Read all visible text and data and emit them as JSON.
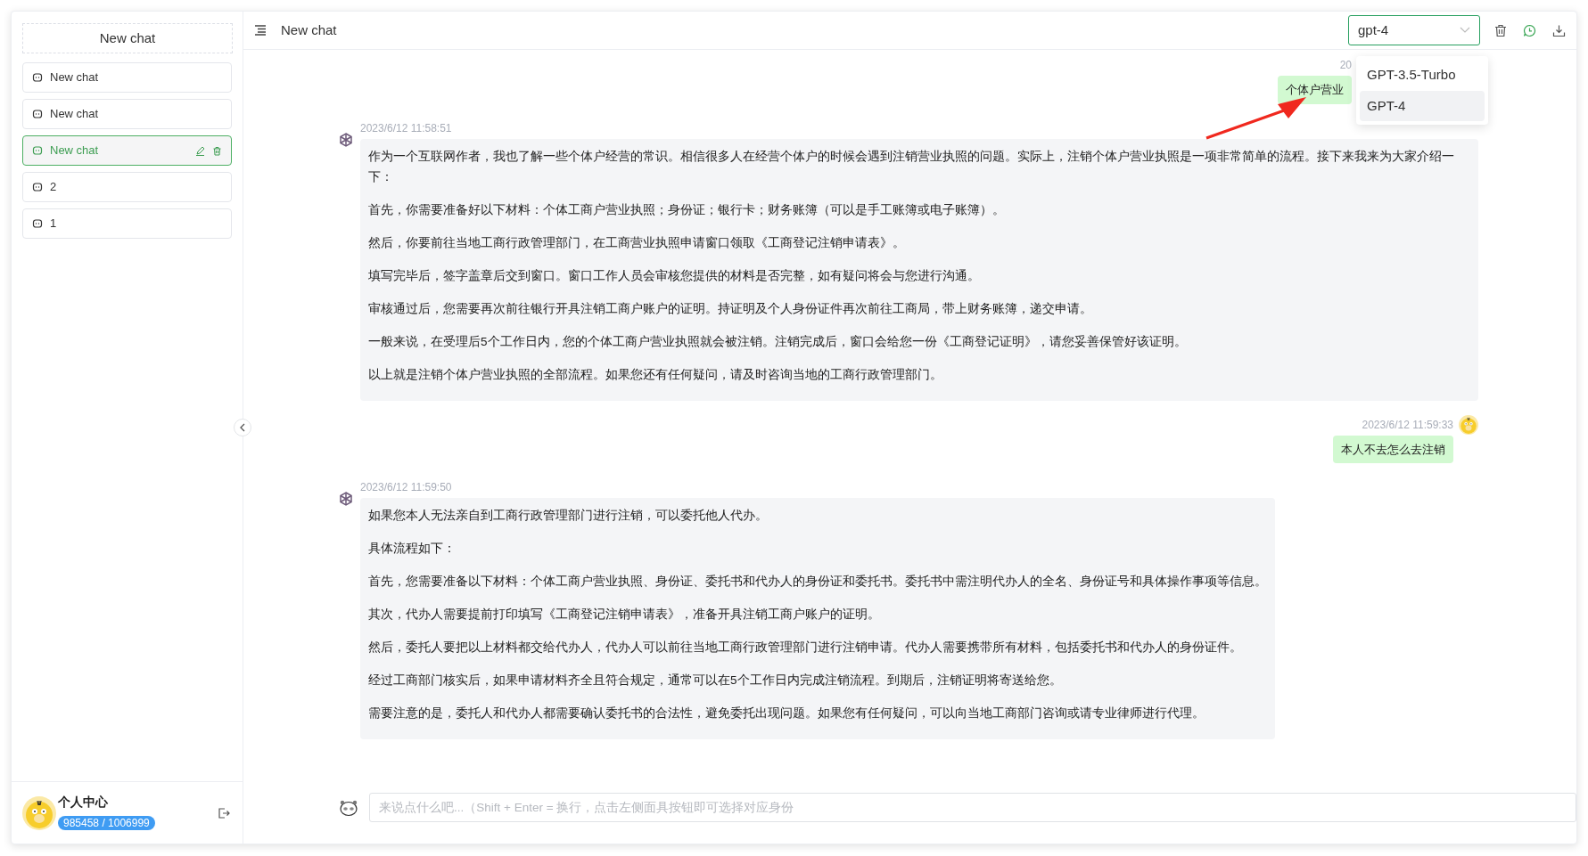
{
  "sidebar": {
    "new_chat_button": "New chat",
    "conversations": [
      {
        "title": "New chat",
        "selected": false
      },
      {
        "title": "New chat",
        "selected": false
      },
      {
        "title": "New chat",
        "selected": true
      },
      {
        "title": "2",
        "selected": false
      },
      {
        "title": "1",
        "selected": false
      }
    ],
    "user": {
      "name": "个人中心",
      "balance": "985458 / 1006999"
    }
  },
  "header": {
    "title": "New chat",
    "model_select": {
      "value": "gpt-4",
      "expanded": true,
      "options": [
        {
          "label": "GPT-3.5-Turbo",
          "selected": false
        },
        {
          "label": "GPT-4",
          "selected": true
        }
      ]
    }
  },
  "messages": [
    {
      "kind": "user",
      "time": "20",
      "paragraphs": [
        "个体户营业"
      ]
    },
    {
      "kind": "assistant",
      "time": "2023/6/12 11:58:51",
      "paragraphs": [
        "作为一个互联网作者，我也了解一些个体户经营的常识。相信很多人在经营个体户的时候会遇到注销营业执照的问题。实际上，注销个体户营业执照是一项非常简单的流程。接下来我来为大家介绍一下：",
        "首先，你需要准备好以下材料：个体工商户营业执照；身份证；银行卡；财务账簿（可以是手工账簿或电子账簿）。",
        "然后，你要前往当地工商行政管理部门，在工商营业执照申请窗口领取《工商登记注销申请表》。",
        "填写完毕后，签字盖章后交到窗口。窗口工作人员会审核您提供的材料是否完整，如有疑问将会与您进行沟通。",
        "审核通过后，您需要再次前往银行开具注销工商户账户的证明。持证明及个人身份证件再次前往工商局，带上财务账簿，递交申请。",
        "一般来说，在受理后5个工作日内，您的个体工商户营业执照就会被注销。注销完成后，窗口会给您一份《工商登记证明》，请您妥善保管好该证明。",
        "以上就是注销个体户营业执照的全部流程。如果您还有任何疑问，请及时咨询当地的工商行政管理部门。"
      ]
    },
    {
      "kind": "user",
      "time": "2023/6/12 11:59:33",
      "paragraphs": [
        "本人不去怎么去注销"
      ]
    },
    {
      "kind": "assistant",
      "time": "2023/6/12 11:59:50",
      "paragraphs": [
        "如果您本人无法亲自到工商行政管理部门进行注销，可以委托他人代办。",
        "具体流程如下：",
        "首先，您需要准备以下材料：个体工商户营业执照、身份证、委托书和代办人的身份证和委托书。委托书中需注明代办人的全名、身份证号和具体操作事项等信息。",
        "其次，代办人需要提前打印填写《工商登记注销申请表》，准备开具注销工商户账户的证明。",
        "然后，委托人要把以上材料都交给代办人，代办人可以前往当地工商行政管理部门进行注销申请。代办人需要携带所有材料，包括委托书和代办人的身份证件。",
        "经过工商部门核实后，如果申请材料齐全且符合规定，通常可以在5个工作日内完成注销流程。到期后，注销证明将寄送给您。",
        "需要注意的是，委托人和代办人都需要确认委托书的合法性，避免委托出现问题。如果您有任何疑问，可以向当地工商部门咨询或请专业律师进行代理。"
      ]
    }
  ],
  "input": {
    "placeholder": "来说点什么吧...（Shift + Enter = 换行，点击左侧面具按钮即可选择对应身份"
  }
}
